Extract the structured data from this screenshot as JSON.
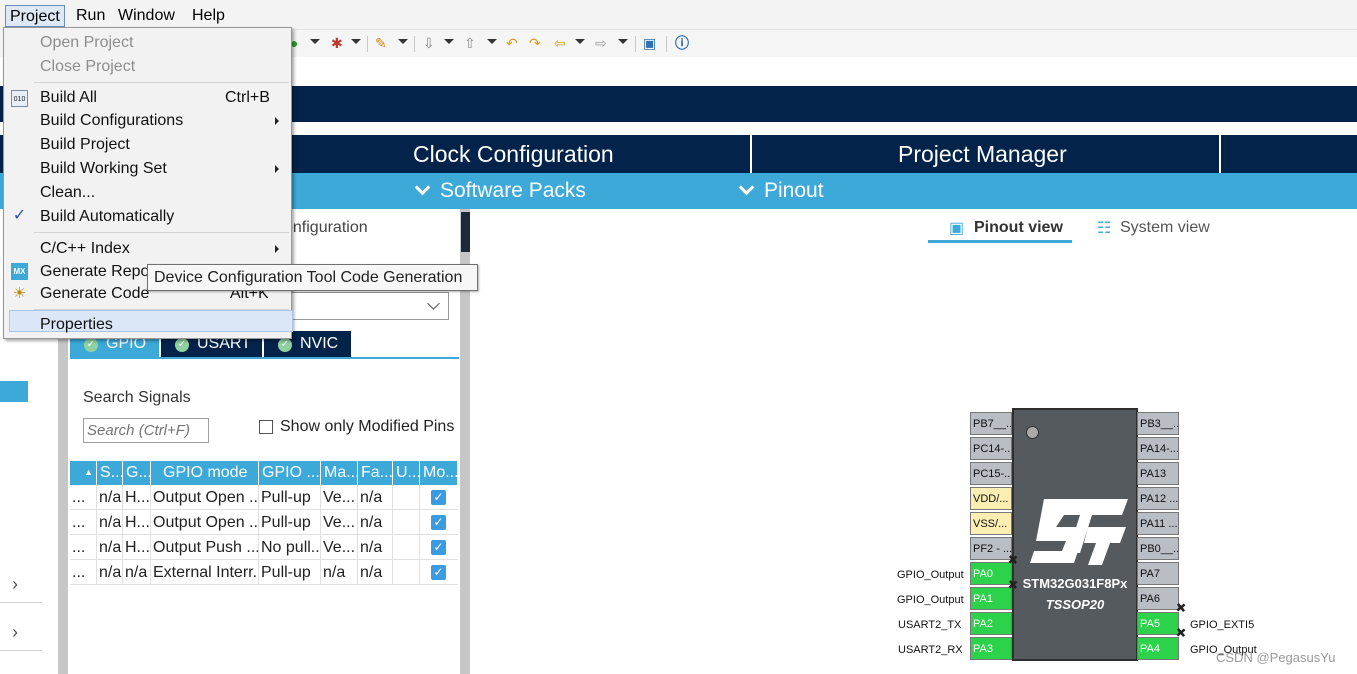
{
  "menubar": {
    "items": [
      "Project",
      "Run",
      "Window",
      "Help"
    ]
  },
  "project_menu": {
    "open_project": "Open Project",
    "close_project": "Close Project",
    "build_all": "Build All",
    "build_all_shortcut": "Ctrl+B",
    "build_configurations": "Build Configurations",
    "build_project": "Build Project",
    "build_working_set": "Build Working Set",
    "clean": "Clean...",
    "build_automatically": "Build Automatically",
    "cc_index": "C/C++ Index",
    "generate_report": "Generate Repo",
    "generate_code": "Generate Code",
    "generate_code_shortcut": "Alt+K",
    "properties": "Properties",
    "mx_icon_text": "MX",
    "binary_icon_text": "010",
    "check_mark": "✓"
  },
  "tooltip": "Device Configuration Tool Code Generation",
  "tabs": {
    "clock": "Clock Configuration",
    "project_manager": "Project Manager"
  },
  "subtabs": {
    "software_packs": "Software Packs",
    "pinout": "Pinout"
  },
  "panel": {
    "title_fragment": "onfiguration",
    "config_tabs": [
      "GPIO",
      "USART",
      "NVIC"
    ],
    "search_label": "Search Signals",
    "search_placeholder": "Search (Ctrl+F)",
    "show_modified": "Show only Modified Pins"
  },
  "gpio_table": {
    "headers": [
      "",
      "S...",
      "G...",
      "GPIO mode",
      "GPIO ...",
      "Ma...",
      "Fa...",
      "U...",
      "Mo..."
    ],
    "rows": [
      [
        "...",
        "n/a",
        "H...",
        "Output Open ...",
        "Pull-up",
        "Ve...",
        "n/a",
        "",
        "checked"
      ],
      [
        "...",
        "n/a",
        "H...",
        "Output Open ...",
        "Pull-up",
        "Ve...",
        "n/a",
        "",
        "checked"
      ],
      [
        "...",
        "n/a",
        "H...",
        "Output Push ...",
        "No pull...",
        "Ve...",
        "n/a",
        "",
        "checked"
      ],
      [
        "...",
        "n/a",
        "n/a",
        "External Interr...",
        "Pull-up",
        "n/a",
        "n/a",
        "",
        "checked"
      ]
    ]
  },
  "view_tabs": {
    "pinout_view": "Pinout view",
    "system_view": "System view"
  },
  "chip": {
    "name": "STM32G031F8Px",
    "package": "TSSOP20",
    "left_pins": [
      "PB7__...",
      "PC14-...",
      "PC15-...",
      "VDD/...",
      "VSS/...",
      "PF2 - ...",
      "PA0",
      "PA1",
      "PA2",
      "PA3"
    ],
    "right_pins": [
      "PB3__...",
      "PA14-...",
      "PA13",
      "PA12 ...",
      "PA11 ...",
      "PB0__...",
      "PA7",
      "PA6",
      "PA5",
      "PA4"
    ],
    "left_labels": [
      "GPIO_Output",
      "GPIO_Output",
      "USART2_TX",
      "USART2_RX"
    ],
    "right_labels": [
      "GPIO_EXTI5",
      "GPIO_Output"
    ]
  },
  "watermark": "CSDN @PegasusYu",
  "colors": {
    "navy": "#03234b",
    "accent": "#3ca9d9",
    "pin_green": "#2bd24a",
    "pin_yellow": "#fbeeb3"
  }
}
